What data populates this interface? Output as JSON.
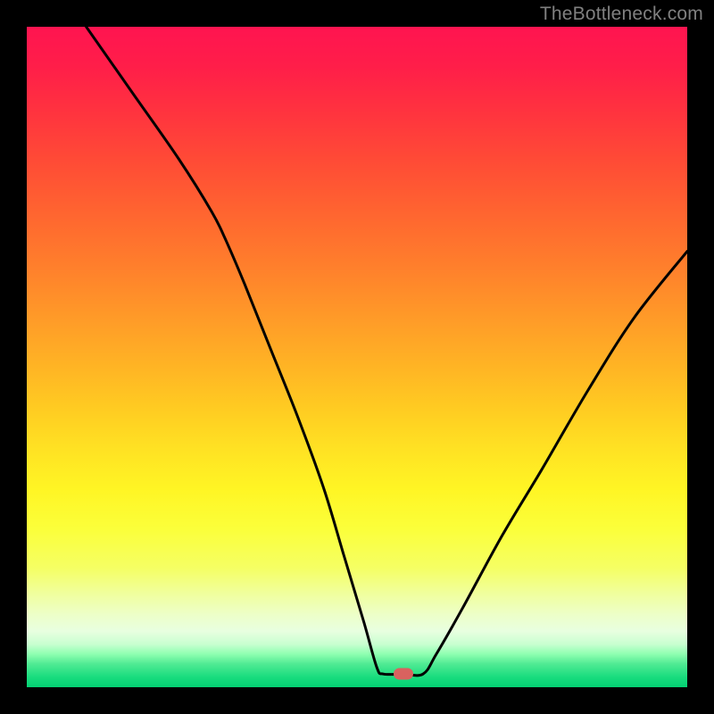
{
  "watermark": "TheBottleneck.com",
  "colors": {
    "curve_stroke": "#000000",
    "marker_fill": "#d9625f",
    "frame_bg": "#000000"
  },
  "gradient_stops": [
    {
      "offset": 0.0,
      "color": "#ff1450"
    },
    {
      "offset": 0.06,
      "color": "#ff1e49"
    },
    {
      "offset": 0.12,
      "color": "#ff3040"
    },
    {
      "offset": 0.2,
      "color": "#ff4a36"
    },
    {
      "offset": 0.28,
      "color": "#ff6430"
    },
    {
      "offset": 0.36,
      "color": "#ff7e2c"
    },
    {
      "offset": 0.44,
      "color": "#ff9a28"
    },
    {
      "offset": 0.52,
      "color": "#ffb624"
    },
    {
      "offset": 0.58,
      "color": "#ffcc22"
    },
    {
      "offset": 0.64,
      "color": "#ffe223"
    },
    {
      "offset": 0.7,
      "color": "#fff524"
    },
    {
      "offset": 0.76,
      "color": "#fbff3a"
    },
    {
      "offset": 0.82,
      "color": "#f5ff64"
    },
    {
      "offset": 0.86,
      "color": "#f0ffa0"
    },
    {
      "offset": 0.89,
      "color": "#edffc8"
    },
    {
      "offset": 0.915,
      "color": "#e8ffe0"
    },
    {
      "offset": 0.935,
      "color": "#c8ffd0"
    },
    {
      "offset": 0.95,
      "color": "#8effb0"
    },
    {
      "offset": 0.965,
      "color": "#4fea93"
    },
    {
      "offset": 0.985,
      "color": "#18dc7e"
    },
    {
      "offset": 1.0,
      "color": "#03d173"
    }
  ],
  "chart_data": {
    "type": "line",
    "title": "",
    "xlabel": "",
    "ylabel": "",
    "xlim": [
      0,
      100
    ],
    "ylim": [
      0,
      100
    ],
    "marker": {
      "x": 57,
      "y": 2
    },
    "series": [
      {
        "name": "bottleneck-curve",
        "points": [
          {
            "x": 9,
            "y": 100
          },
          {
            "x": 16,
            "y": 90
          },
          {
            "x": 23,
            "y": 80
          },
          {
            "x": 28,
            "y": 72
          },
          {
            "x": 30,
            "y": 68
          },
          {
            "x": 33,
            "y": 61
          },
          {
            "x": 37,
            "y": 51
          },
          {
            "x": 41,
            "y": 41
          },
          {
            "x": 45,
            "y": 30
          },
          {
            "x": 48,
            "y": 20
          },
          {
            "x": 51,
            "y": 10
          },
          {
            "x": 53,
            "y": 3
          },
          {
            "x": 54,
            "y": 2
          },
          {
            "x": 57,
            "y": 2
          },
          {
            "x": 60,
            "y": 2
          },
          {
            "x": 62,
            "y": 5
          },
          {
            "x": 66,
            "y": 12
          },
          {
            "x": 72,
            "y": 23
          },
          {
            "x": 78,
            "y": 33
          },
          {
            "x": 85,
            "y": 45
          },
          {
            "x": 92,
            "y": 56
          },
          {
            "x": 100,
            "y": 66
          }
        ]
      }
    ]
  }
}
